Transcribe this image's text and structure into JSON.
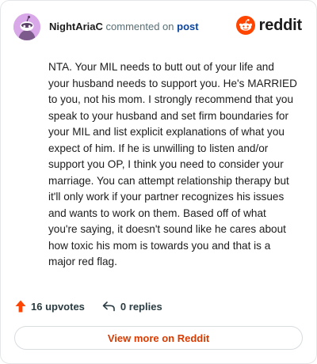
{
  "comment": {
    "username": "NightAriaC",
    "verb": "commented on",
    "post_link": "post",
    "body": "NTA. Your MIL needs to butt out of your life and your husband needs to support you. He's MARRIED to you, not his mom. I strongly recommend that you speak to your husband and set firm boundaries for your MIL and list explicit explanations of what you expect of him. If he is unwilling to listen and/or support you OP, I think you need to consider your marriage. You can attempt relationship therapy but it'll only work if your partner recognizes his issues and wants to work on them. Based off of what you're saying, it doesn't sound like he cares about how toxic his mom is towards you and that is a major red flag."
  },
  "brand": {
    "wordmark": "reddit",
    "accent_color": "#ff4500",
    "icon": "reddit-snoo-icon"
  },
  "actions": {
    "upvotes_label": "16 upvotes",
    "upvote_icon": "upvote-arrow-icon",
    "replies_label": "0 replies",
    "reply_icon": "reply-arrow-icon"
  },
  "footer": {
    "view_more_label": "View more on Reddit"
  }
}
